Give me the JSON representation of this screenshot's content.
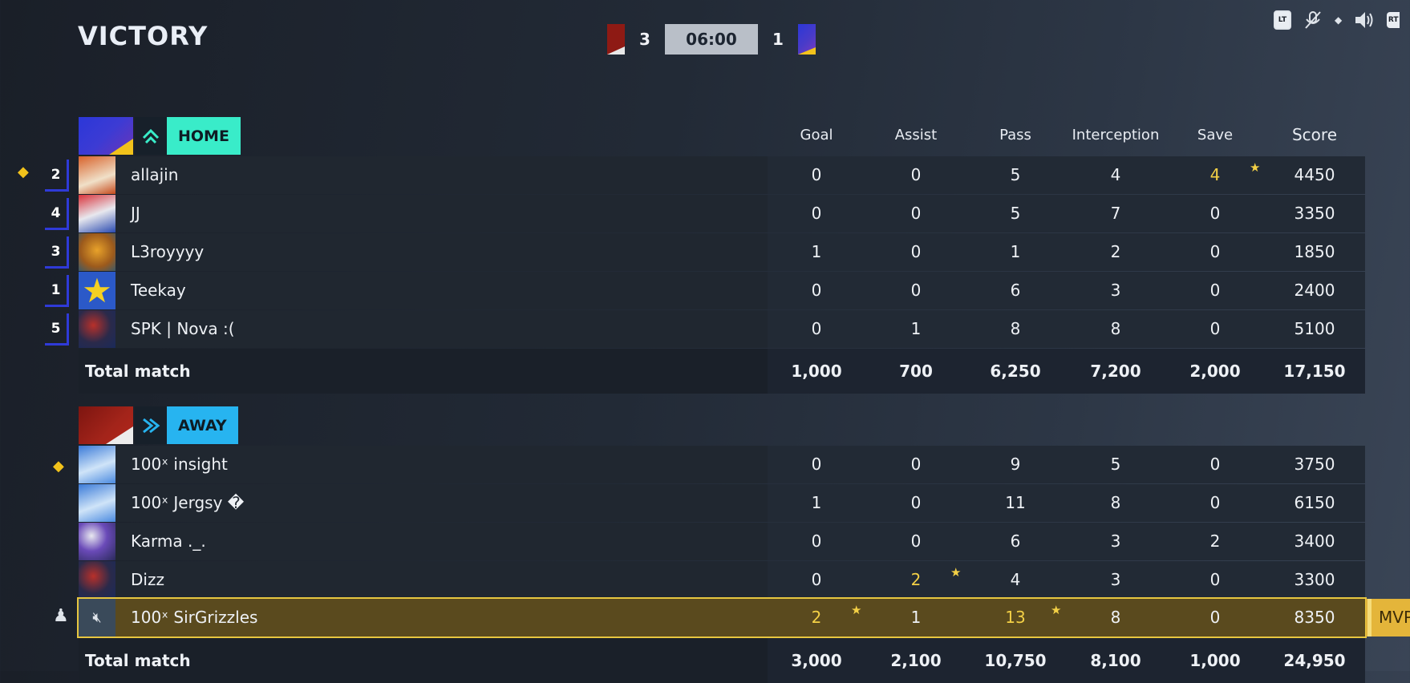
{
  "result": "VICTORY",
  "scoreboard": {
    "home_score": "3",
    "time": "06:00",
    "away_score": "1"
  },
  "columns": [
    "Goal",
    "Assist",
    "Pass",
    "Interception",
    "Save",
    "Score"
  ],
  "home": {
    "tag": "HOME",
    "players": [
      {
        "rank": "2",
        "name": "allajin",
        "stats": [
          "0",
          "0",
          "5",
          "4",
          "4",
          "4450"
        ]
      },
      {
        "rank": "4",
        "name": "JJ",
        "stats": [
          "0",
          "0",
          "5",
          "7",
          "0",
          "3350"
        ]
      },
      {
        "rank": "3",
        "name": "L3royyyy",
        "stats": [
          "1",
          "0",
          "1",
          "2",
          "0",
          "1850"
        ]
      },
      {
        "rank": "1",
        "name": "Teekay",
        "stats": [
          "0",
          "0",
          "6",
          "3",
          "0",
          "2400"
        ]
      },
      {
        "rank": "5",
        "name": "SPK | Nova :(",
        "stats": [
          "0",
          "1",
          "8",
          "8",
          "0",
          "5100"
        ]
      }
    ],
    "total_label": "Total match",
    "totals": [
      "1,000",
      "700",
      "6,250",
      "7,200",
      "2,000",
      "17,150"
    ]
  },
  "away": {
    "tag": "AWAY",
    "players": [
      {
        "name": "100ˣ insight",
        "stats": [
          "0",
          "0",
          "9",
          "5",
          "0",
          "3750"
        ]
      },
      {
        "name": "100ˣ Jergsy �",
        "stats": [
          "1",
          "0",
          "11",
          "8",
          "0",
          "6150"
        ]
      },
      {
        "name": "Karma ._.",
        "stats": [
          "0",
          "0",
          "6",
          "3",
          "2",
          "3400"
        ]
      },
      {
        "name": "Dizz",
        "stats": [
          "0",
          "2",
          "4",
          "3",
          "0",
          "3300"
        ]
      },
      {
        "name": "100ˣ SirGrizzles",
        "stats": [
          "2",
          "1",
          "13",
          "8",
          "0",
          "8350"
        ]
      }
    ],
    "total_label": "Total match",
    "totals": [
      "3,000",
      "2,100",
      "10,750",
      "8,100",
      "1,000",
      "24,950"
    ]
  },
  "mvp_label": "MVP",
  "hud": {
    "lt": "LT",
    "rt": "RT"
  }
}
